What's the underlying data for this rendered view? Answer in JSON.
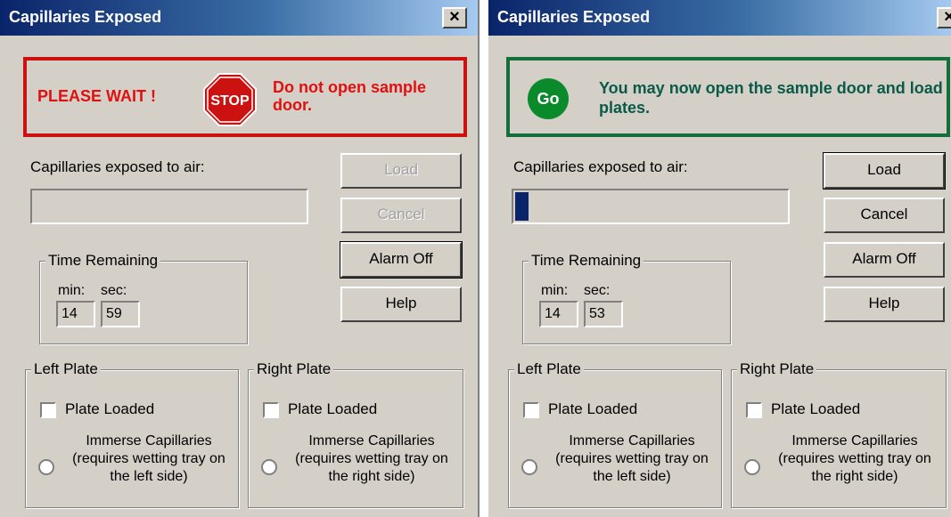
{
  "dialogs": [
    {
      "title": "Capillaries Exposed",
      "close_label": "×",
      "status": {
        "state": "stop",
        "left_text": "PLEASE WAIT !",
        "icon": "stop-sign-icon",
        "icon_text": "STOP",
        "message": "Do not open sample door.",
        "color": "#cc1111"
      },
      "cap_label": "Capillaries exposed to air:",
      "progress_fraction": 0.0,
      "buttons": {
        "load": "Load",
        "cancel": "Cancel",
        "alarm_off": "Alarm Off",
        "help": "Help"
      },
      "buttons_enabled": {
        "load": false,
        "cancel": false,
        "alarm_off": true,
        "help": true
      },
      "time": {
        "legend": "Time Remaining",
        "min_label": "min:",
        "sec_label": "sec:",
        "min": "14",
        "sec": "59"
      },
      "left_plate": {
        "legend": "Left Plate",
        "loaded_label": "Plate Loaded",
        "immerse_label": "Immerse Capillaries (requires wetting tray on the left side)"
      },
      "right_plate": {
        "legend": "Right Plate",
        "loaded_label": "Plate Loaded",
        "immerse_label": "Immerse Capillaries (requires wetting tray on the right side)"
      }
    },
    {
      "title": "Capillaries Exposed",
      "close_label": "×",
      "status": {
        "state": "go",
        "icon": "go-icon",
        "icon_text": "Go",
        "message": "You may now open the sample door and load plates.",
        "color": "#156f3a"
      },
      "cap_label": "Capillaries exposed to air:",
      "progress_fraction": 0.05,
      "buttons": {
        "load": "Load",
        "cancel": "Cancel",
        "alarm_off": "Alarm Off",
        "help": "Help"
      },
      "buttons_enabled": {
        "load": true,
        "cancel": true,
        "alarm_off": true,
        "help": true
      },
      "time": {
        "legend": "Time Remaining",
        "min_label": "min:",
        "sec_label": "sec:",
        "min": "14",
        "sec": "53"
      },
      "left_plate": {
        "legend": "Left Plate",
        "loaded_label": "Plate Loaded",
        "immerse_label": "Immerse Capillaries (requires wetting tray on the left side)"
      },
      "right_plate": {
        "legend": "Right Plate",
        "loaded_label": "Plate Loaded",
        "immerse_label": "Immerse Capillaries (requires wetting tray on the right side)"
      }
    }
  ]
}
